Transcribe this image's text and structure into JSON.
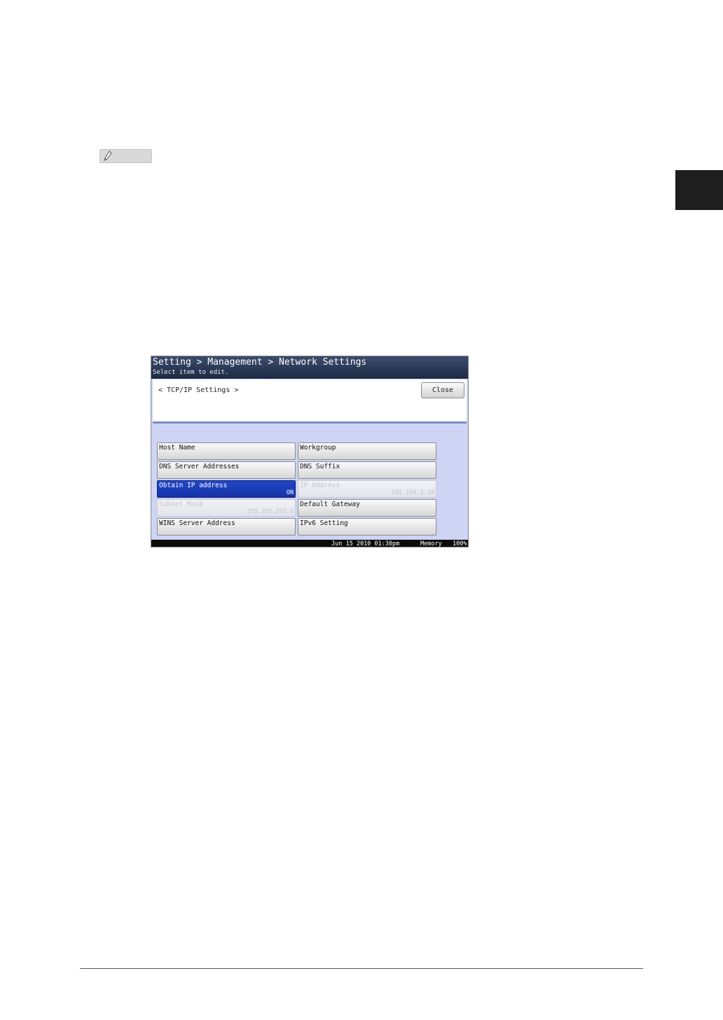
{
  "doc": {
    "note_icon": "pencil-note-icon",
    "colors": {
      "side_tab": "#1e1e1e",
      "note_badge": "#d9d9d9",
      "rule": "#555555"
    }
  },
  "screen": {
    "breadcrumb": "Setting > Management > Network Settings",
    "hint": "Select item to edit.",
    "section_title": "< TCP/IP Settings >",
    "close_label": "Close",
    "buttons": {
      "host_name": {
        "label": "Host Name"
      },
      "workgroup": {
        "label": "Workgroup"
      },
      "dns_servers": {
        "label": "DNS Server Addresses"
      },
      "dns_suffix": {
        "label": "DNS Suffix"
      },
      "obtain_ip": {
        "label": "Obtain IP address",
        "value": "ON"
      },
      "ip_address": {
        "label": "IP Address",
        "value": "192.168.1.10"
      },
      "subnet_mask": {
        "label": "Subnet Mask",
        "value": "255.255.255.0"
      },
      "default_gateway": {
        "label": "Default Gateway"
      },
      "wins_server": {
        "label": "WINS Server Address"
      },
      "ipv6": {
        "label": "IPv6 Setting"
      }
    },
    "status": {
      "datetime": "Jun 15 2010 01:30pm",
      "memory_label": "Memory",
      "memory_value": "100%"
    },
    "colors": {
      "selected": "#1a3cb8",
      "titlebar": "#2a3858",
      "panel_bg": "#cdd4f4"
    }
  }
}
